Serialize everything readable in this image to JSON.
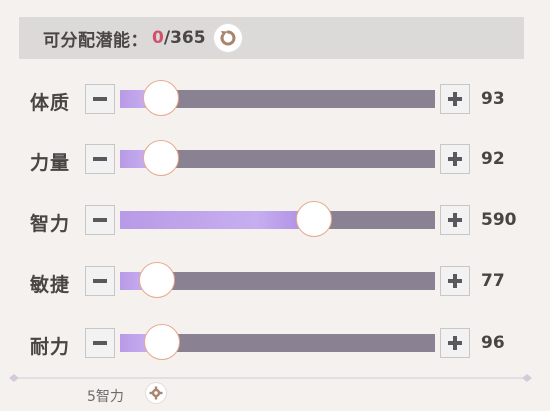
{
  "header": {
    "label": "可分配潜能：",
    "current": "0",
    "separator": "/",
    "max": "365"
  },
  "stats": [
    {
      "name": "体质",
      "value": "93",
      "slider_fraction": 0.13
    },
    {
      "name": "力量",
      "value": "92",
      "slider_fraction": 0.13
    },
    {
      "name": "智力",
      "value": "590",
      "slider_fraction": 0.615
    },
    {
      "name": "敏捷",
      "value": "77",
      "slider_fraction": 0.117
    },
    {
      "name": "耐力",
      "value": "96",
      "slider_fraction": 0.133
    }
  ],
  "footer": {
    "preset_label": "5智力"
  },
  "icons": {
    "reset": "reset-icon",
    "minus": "minus-icon",
    "plus": "plus-icon",
    "gear": "gear-icon"
  },
  "colors": {
    "accent_current": "#d2506a",
    "fill": "#c0a4ec",
    "track": "#8a8292",
    "knob_border": "#e7a98d",
    "icon_brown": "#a9856e"
  }
}
